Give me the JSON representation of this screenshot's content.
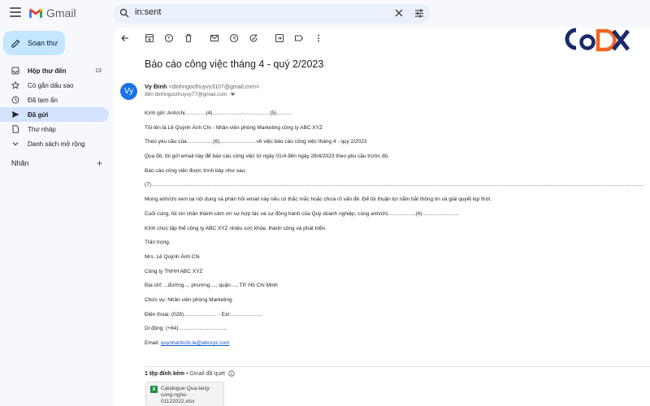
{
  "header": {
    "app_name": "Gmail",
    "search_value": "in:sent"
  },
  "sidebar": {
    "compose_label": "Soạn thư",
    "items": [
      {
        "label": "Hộp thư đến",
        "count": "13",
        "icon": "inbox-icon"
      },
      {
        "label": "Có gắn dấu sao",
        "icon": "star-icon"
      },
      {
        "label": "Đã tạm ẩn",
        "icon": "clock-icon"
      },
      {
        "label": "Đã gửi",
        "icon": "send-icon"
      },
      {
        "label": "Thư nháp",
        "icon": "draft-icon"
      },
      {
        "label": "Danh sách mở rộng",
        "icon": "chevron-down-icon"
      }
    ],
    "labels_title": "Nhãn",
    "labels_add": "+"
  },
  "email": {
    "subject": "Báo cáo công việc tháng 4 - quý 2/2023",
    "avatar_initials": "Vy",
    "sender_name": "Vy Đinh",
    "sender_email": "<dinhngocthuyvy3107@gmail.com>",
    "recipient": "đến dinhngocthuyvy77@gmail.com",
    "lines": [
      "Kính gửi: Anh/chị…………(4)……………..-……………(5)………",
      "Tôi tên là Lê Quỳnh Ánh Chi - Nhân viên phòng Marketing công ty ABC XYZ",
      "Theo yêu cầu của……………(6)…………………về việc báo cáo công việc tháng 4 - quý 2/2023",
      "Qua đó, tôi gửi email này để báo cáo công việc từ ngày 01/4 đến ngày 28/4/2023 theo yêu cầu trước đó.",
      "Báo cáo công việc được trình bày như sau:",
      "(7)…………………………………………………………………………………………………………………………………………………………………………………………………………………………………………………………",
      "Mong anh/chị xem lại nội dung và phản hồi email này nếu có thắc mắc hoặc chưa rõ vấn đề. Để tôi thuận lợi nắm bắt thông tin và giải quyết kịp thời.",
      "Cuối cùng, tôi xin chân thành cảm ơn sự hợp tác và sự đồng hành của Quý doanh nghiệp, cùng anh/chị…………….(4)…………………",
      "Kính chúc tập thể công ty ABC XYZ nhiều sức khỏe, thành công và phát triển.",
      "Trân trọng,",
      "Mrs. Lê Quỳnh Ánh Chi",
      "Công ty TNHH ABC XYZ",
      "Địa chỉ: ...đường..., phường...., quận...., TP. Hồ Chí Minh",
      "Chức vụ: Nhân viên phòng Marketing",
      "Điện thoại: (028)………………. - Ext:………………",
      "Di động: (+84)………………………."
    ],
    "email_label": "Email: ",
    "email_link": "quynhanhchi.le@abcxyz.com"
  },
  "attachments": {
    "heading": "1 tệp đính kèm",
    "scan_note": " • Gmail đã quét",
    "file_name": "Catalogue-Qua-tang-cong-nghe-01122022.xlsx",
    "file_icon": "X"
  },
  "brand": {
    "text": "CoDX",
    "colors": {
      "primary": "#1b2a6b",
      "accent": "#f26522"
    }
  },
  "colors": {
    "background": "#f6f8fc",
    "compose": "#c2e7ff",
    "active_nav": "#d3e3fd",
    "avatar": "#1a73e8",
    "link": "#1155cc"
  }
}
